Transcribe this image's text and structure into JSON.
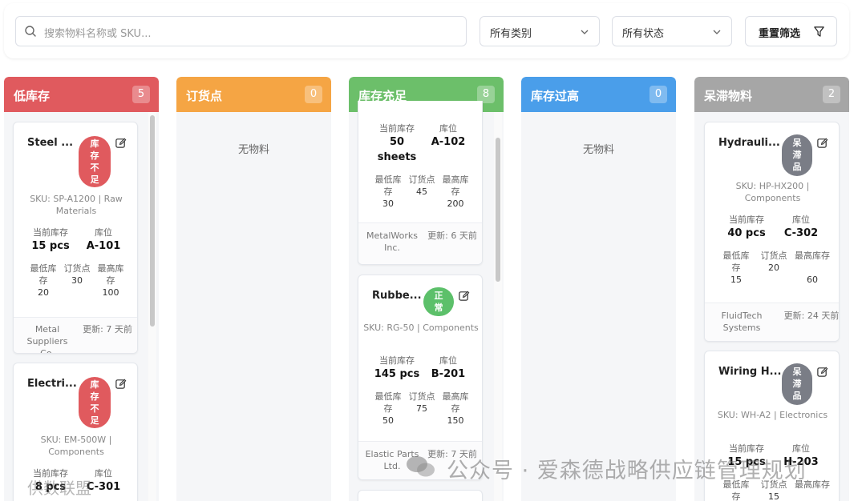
{
  "search": {
    "placeholder": "搜索物料名称或 SKU..."
  },
  "filters": {
    "category": "所有类别",
    "status": "所有状态",
    "reset_label": "重置筛选"
  },
  "columns": [
    {
      "title": "低库存",
      "count": "5",
      "color": "#e05a5e"
    },
    {
      "title": "订货点",
      "count": "0",
      "color": "#f5a544",
      "empty": "无物料"
    },
    {
      "title": "库存充足",
      "count": "8",
      "color": "#6cbf6a"
    },
    {
      "title": "库存过高",
      "count": "0",
      "color": "#4a9eea",
      "empty": "无物料"
    },
    {
      "title": "呆滞物料",
      "count": "2",
      "color": "#a6a6a6"
    }
  ],
  "labels": {
    "current_stock": "当前库存",
    "location": "库位",
    "min_stock": "最低库存",
    "reorder_point": "订货点",
    "max_stock": "最高库存"
  },
  "cards": {
    "steel": {
      "name": "Steel ...",
      "badge": "库存不足",
      "sku": "SKU: SP-A1200 | Raw Materials",
      "stock": "15 pcs",
      "location": "A-101",
      "min": "20",
      "reorder": "30",
      "max": "100",
      "supplier": "Metal Suppliers Co.",
      "updated": "更新: 7 天前"
    },
    "electric": {
      "name": "Electri...",
      "badge": "库存不足",
      "sku": "SKU: EM-500W | Components",
      "stock": "8 pcs",
      "location": "C-301"
    },
    "sheets": {
      "stock": "50 sheets",
      "location": "A-102",
      "min": "30",
      "reorder": "45",
      "max": "200",
      "supplier": "MetalWorks Inc.",
      "updated": "更新: 6 天前"
    },
    "rubber": {
      "name": "Rubbe...",
      "badge": "正常",
      "sku": "SKU: RG-50 | Components",
      "stock": "145 pcs",
      "location": "B-201",
      "min": "50",
      "reorder": "75",
      "max": "150",
      "supplier": "Elastic Parts Ltd.",
      "updated": "更新: 7 天前"
    },
    "hydraulic": {
      "name": "Hydrauli...",
      "badge": "呆滞品",
      "sku": "SKU: HP-HX200 | Components",
      "stock": "40 pcs",
      "location": "C-302",
      "min": "15",
      "reorder": "20",
      "max": "60",
      "supplier": "FluidTech Systems",
      "updated": "更新: 24 天前"
    },
    "wiring": {
      "name": "Wiring H...",
      "badge": "呆滞品",
      "sku": "SKU: WH-A2 | Electronics",
      "stock": "15 pcs",
      "location": "H-203",
      "reorder": "15"
    }
  },
  "colors": {
    "danger": "#e05a5e",
    "success": "#5cc06a",
    "stale": "#7a7d86"
  },
  "watermark": {
    "main": "公众号 · 爱森德战略供应链管理规划",
    "left": "供数联盟"
  }
}
